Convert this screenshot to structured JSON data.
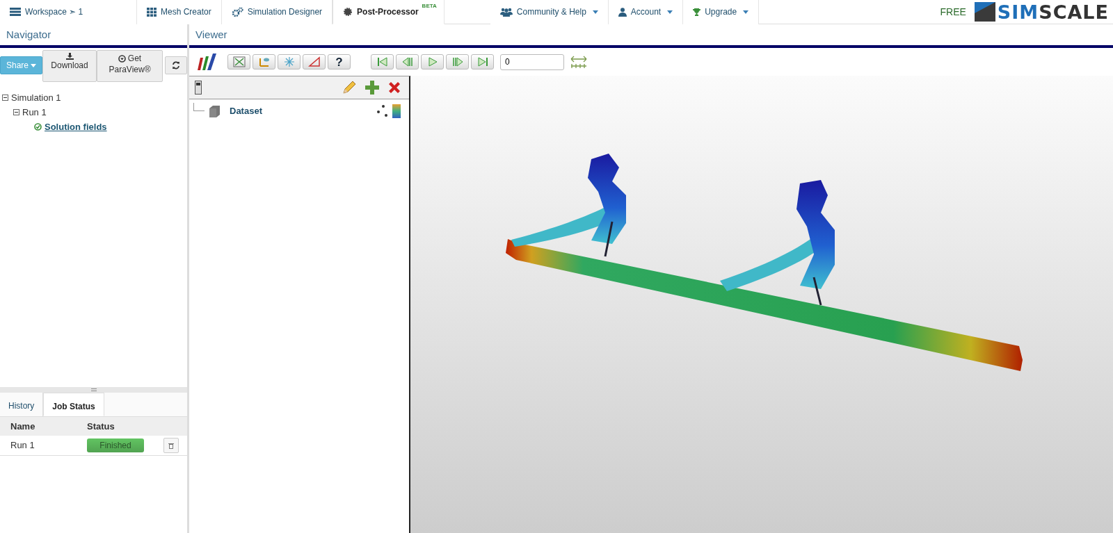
{
  "top_nav": {
    "tabs": [
      {
        "label": "Workspace ➣ 1",
        "selected": false
      },
      {
        "label": "Mesh Creator",
        "selected": false
      },
      {
        "label": "Simulation Designer",
        "selected": false
      },
      {
        "label": "Post-Processor",
        "selected": true,
        "badge": "BETA"
      }
    ],
    "menus": [
      {
        "label": "Community & Help"
      },
      {
        "label": "Account"
      },
      {
        "label": "Upgrade"
      }
    ],
    "plan": "FREE",
    "logo": [
      "SIM",
      "SCALE"
    ]
  },
  "navigator": {
    "title": "Navigator",
    "buttons": [
      {
        "kind": "dropdown",
        "label": "Share"
      },
      {
        "kind": "icon-text",
        "label": "Download"
      },
      {
        "kind": "icon-text",
        "label": "Get ParaView®"
      },
      {
        "kind": "icon"
      }
    ],
    "tree": [
      {
        "label": "Simulation 1",
        "kind": "node",
        "expanded": true,
        "children": [
          {
            "label": "Run 1",
            "kind": "node",
            "expanded": true,
            "children": [
              {
                "label": "Solution fields",
                "kind": "result"
              }
            ]
          }
        ]
      }
    ]
  },
  "bottom_panel": {
    "tabs": [
      {
        "label": "History",
        "selected": false
      },
      {
        "label": "Job Status",
        "selected": true
      }
    ],
    "table": {
      "columns": [
        "Name",
        "Status"
      ],
      "rows": [
        {
          "name": "Run 1",
          "status": "Finished"
        }
      ]
    }
  },
  "viewer": {
    "title": "Viewer",
    "help_label": "?",
    "frame_value": "0",
    "pipeline": {
      "items": [
        {
          "label": "Dataset"
        }
      ]
    }
  }
}
